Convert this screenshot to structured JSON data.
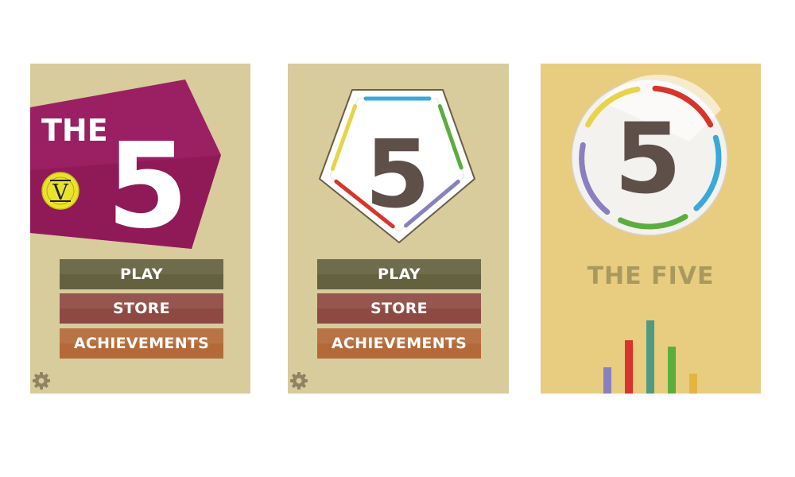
{
  "screens": [
    {
      "logo": {
        "the": "THE",
        "numeral": "5",
        "badge": "V",
        "banner_color": "#9b1f63",
        "badge_color": "#ebe32b"
      },
      "menu": {
        "play": "PLAY",
        "store": "STORE",
        "achievements": "ACHIEVEMENTS"
      },
      "settings_icon": "gear-icon"
    },
    {
      "logo": {
        "numeral": "5",
        "ring_colors": [
          "#3aa8d8",
          "#5bae3e",
          "#8a7fc0",
          "#d9342b",
          "#e8d34a"
        ]
      },
      "menu": {
        "play": "PLAY",
        "store": "STORE",
        "achievements": "ACHIEVEMENTS"
      },
      "settings_icon": "gear-icon"
    },
    {
      "logo": {
        "numeral": "5",
        "ring_colors": [
          "#d9342b",
          "#3aa8d8",
          "#5bae3e",
          "#8a7fc0",
          "#e8d34a"
        ]
      },
      "title": "THE FIVE",
      "bar_colors": [
        "#8a7fc0",
        "#d9342b",
        "#4f9a80",
        "#5bae3e",
        "#e2b53e"
      ],
      "bar_levels": [
        0.36,
        0.73,
        1.0,
        0.64,
        0.27
      ]
    }
  ],
  "colors": {
    "panel_tan": "#d8cb9c",
    "panel_yellow": "#e8cc80",
    "numeral_dark": "#5e5049",
    "play_button": "#64613f",
    "store_button": "#8e4a42",
    "achievements_button": "#b46a38"
  }
}
